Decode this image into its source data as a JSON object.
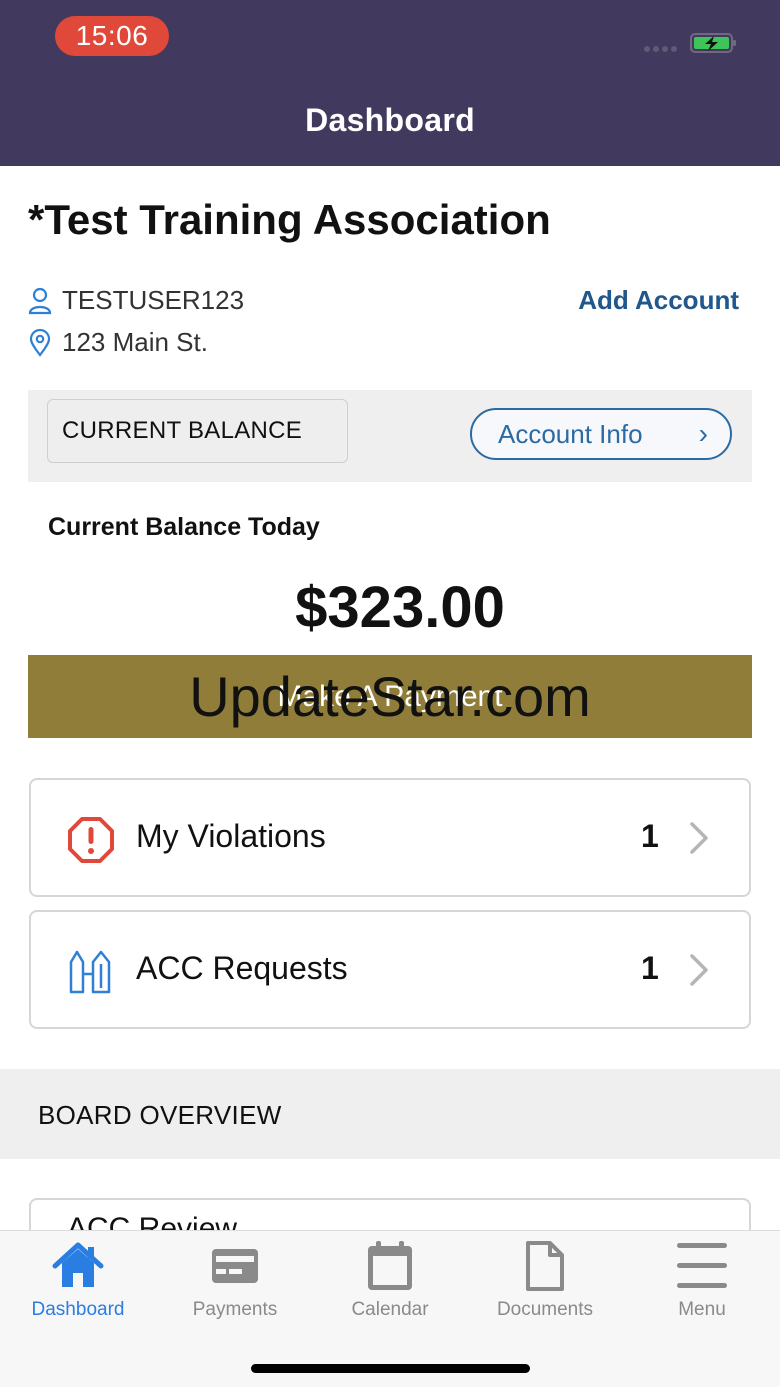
{
  "status_bar": {
    "time": "15:06"
  },
  "header": {
    "title": "Dashboard"
  },
  "association": {
    "name": "*Test Training Association",
    "username": "TESTUSER123",
    "address": "123 Main St.",
    "add_account_label": "Add Account"
  },
  "balance": {
    "tab_label": "CURRENT BALANCE",
    "account_info_label": "Account Info",
    "today_label": "Current Balance Today",
    "amount": "$323.00",
    "pay_button_label": "Make A Payment",
    "watermark": "UpdateStar.com"
  },
  "cards": [
    {
      "label": "My Violations",
      "count": "1",
      "icon": "alert-octagon-icon"
    },
    {
      "label": "ACC Requests",
      "count": "1",
      "icon": "building-icon"
    }
  ],
  "board": {
    "title": "BOARD OVERVIEW",
    "partial_card_label": "ACC Review"
  },
  "tabbar": {
    "items": [
      {
        "label": "Dashboard",
        "icon": "home-icon",
        "active": true
      },
      {
        "label": "Payments",
        "icon": "credit-card-icon",
        "active": false
      },
      {
        "label": "Calendar",
        "icon": "calendar-icon",
        "active": false
      },
      {
        "label": "Documents",
        "icon": "document-icon",
        "active": false
      },
      {
        "label": "Menu",
        "icon": "menu-icon",
        "active": false
      }
    ]
  },
  "colors": {
    "header_bg": "#413a5e",
    "accent_blue": "#2c6aa3",
    "pay_button": "#907d3a",
    "alert_red": "#e0493a",
    "tab_active": "#2a7de1"
  }
}
